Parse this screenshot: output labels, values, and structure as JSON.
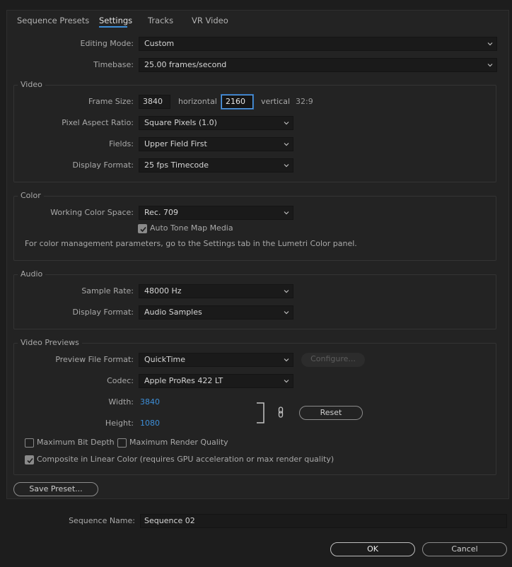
{
  "tabs": [
    "Sequence Presets",
    "Settings",
    "Tracks",
    "VR Video"
  ],
  "editing_mode": {
    "label": "Editing Mode:",
    "value": "Custom"
  },
  "timebase": {
    "label": "Timebase:",
    "value": "25.00  frames/second"
  },
  "video": {
    "title": "Video",
    "frame_size_label": "Frame Size:",
    "width": "3840",
    "horizontal": "horizontal",
    "height": "2160",
    "vertical": "vertical",
    "ratio": "32:9",
    "par_label": "Pixel Aspect Ratio:",
    "par_value": "Square Pixels (1.0)",
    "fields_label": "Fields:",
    "fields_value": "Upper Field First",
    "display_label": "Display Format:",
    "display_value": "25 fps Timecode"
  },
  "color": {
    "title": "Color",
    "wcs_label": "Working Color Space:",
    "wcs_value": "Rec. 709",
    "auto_tone": "Auto Tone Map Media",
    "auto_tone_checked": true,
    "note": "For color management parameters, go to the Settings tab in the Lumetri Color panel."
  },
  "audio": {
    "title": "Audio",
    "rate_label": "Sample Rate:",
    "rate_value": "48000 Hz",
    "display_label": "Display Format:",
    "display_value": "Audio Samples"
  },
  "previews": {
    "title": "Video Previews",
    "format_label": "Preview File Format:",
    "format_value": "QuickTime",
    "configure": "Configure...",
    "codec_label": "Codec:",
    "codec_value": "Apple ProRes 422 LT",
    "width_label": "Width:",
    "width_value": "3840",
    "height_label": "Height:",
    "height_value": "1080",
    "reset": "Reset",
    "max_bit_depth": "Maximum Bit Depth",
    "max_render": "Maximum Render Quality",
    "composite": "Composite in Linear Color (requires GPU acceleration or max render quality)",
    "max_bit_depth_checked": false,
    "max_render_checked": false,
    "composite_checked": true
  },
  "save_preset": "Save Preset...",
  "sequence_name": {
    "label": "Sequence Name:",
    "value": "Sequence 02"
  },
  "ok": "OK",
  "cancel": "Cancel",
  "colors": {
    "accent": "#3d8fd9",
    "background": "#1d1d1d",
    "panel": "#232323"
  }
}
